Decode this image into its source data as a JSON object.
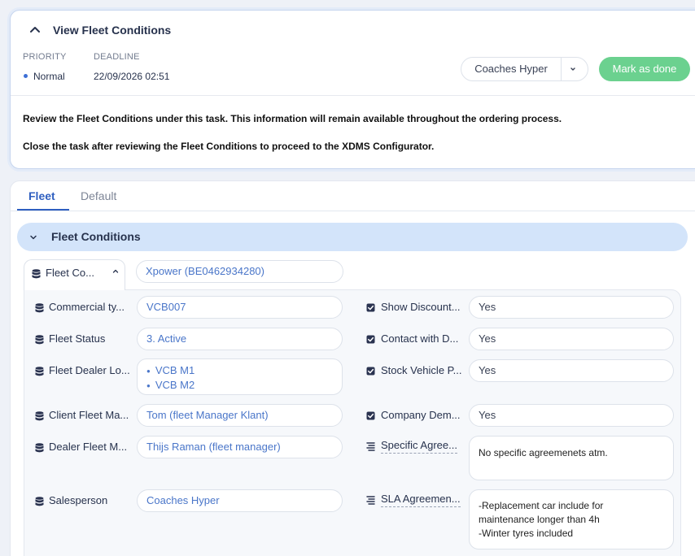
{
  "task": {
    "title": "View Fleet Conditions",
    "priority_label": "PRIORITY",
    "priority_value": "Normal",
    "deadline_label": "DEADLINE",
    "deadline_value": "22/09/2026 02:51",
    "assignee": "Coaches Hyper",
    "mark_done": "Mark as done",
    "instruction_1": "Review the Fleet Conditions under this task. This information will remain available throughout the ordering process.",
    "instruction_2": "Close the task after reviewing the Fleet Conditions to proceed to the XDMS Configurator."
  },
  "tabs": [
    "Fleet",
    "Default"
  ],
  "section_title": "Fleet Conditions",
  "group": {
    "label": "Fleet Co...",
    "value": "Xpower (BE0462934280)"
  },
  "left_fields": [
    {
      "label": "Commercial ty...",
      "value": "VCB007"
    },
    {
      "label": "Fleet Status",
      "value": "3. Active"
    },
    {
      "label": "Fleet Dealer Lo...",
      "values": [
        "VCB M1",
        "VCB M2"
      ]
    },
    {
      "label": "Client Fleet Ma...",
      "value": "Tom (fleet Manager Klant)"
    },
    {
      "label": "Dealer Fleet M...",
      "value": "Thijs Raman (fleet manager)"
    },
    {
      "label": "Salesperson",
      "value": "Coaches Hyper"
    }
  ],
  "right_fields": [
    {
      "label": "Show Discount...",
      "value": "Yes"
    },
    {
      "label": "Contact with D...",
      "value": "Yes"
    },
    {
      "label": "Stock Vehicle P...",
      "value": "Yes"
    },
    {
      "label": "Company Dem...",
      "value": "Yes"
    },
    {
      "label": "Specific Agree...",
      "value": "No specific agreemenets atm."
    },
    {
      "label": "SLA Agreemen...",
      "lines": [
        "-Replacement car include for",
        "maintenance longer than 4h",
        "-Winter tyres included"
      ]
    }
  ],
  "colors": {
    "accent": "#2f5fc0",
    "success": "#6bd18f",
    "section_bg": "#d3e4fa",
    "link": "#4a76c9"
  }
}
